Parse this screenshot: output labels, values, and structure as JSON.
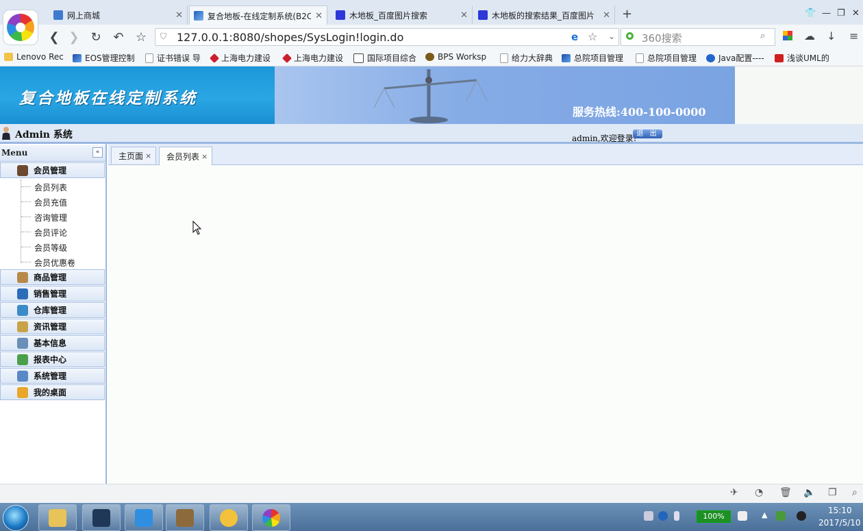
{
  "browser": {
    "tabs": [
      {
        "label": "网上商城",
        "active": false
      },
      {
        "label": "复合地板-在线定制系统(B2C",
        "active": true
      },
      {
        "label": "木地板_百度图片搜索",
        "active": false
      },
      {
        "label": "木地板的搜索结果_百度图片",
        "active": false
      }
    ],
    "new_tab": "+",
    "window_controls": [
      "shirt-icon",
      "minimize-icon",
      "restore-icon",
      "close-icon"
    ],
    "url": "127.0.0.1:8080/shopes/SysLogin!login.do",
    "search_placeholder": "360搜索",
    "bookmarks": [
      "Lenovo Rec",
      "EOS管理控制",
      "证书错误 导",
      "上海电力建设",
      "上海电力建设",
      "国际项目综合",
      "BPS Worksp",
      "给力大辞典",
      "总院项目管理",
      "总院项目管理",
      "Java配置----",
      "浅谈UML的"
    ]
  },
  "app": {
    "title": "复合地板在线定制系统",
    "hotline": "服务热线:400-100-0000",
    "admin_label": "Admin 系统",
    "welcome": "admin,欢迎登录!",
    "logout_label": "退 出"
  },
  "sidebar": {
    "title": "Menu",
    "collapse_icon": "«",
    "groups": [
      {
        "label": "会员管理",
        "expanded": true,
        "items": [
          "会员列表",
          "会员充值",
          "咨询管理",
          "会员评论",
          "会员等级",
          "会员优惠卷"
        ]
      },
      {
        "label": "商品管理"
      },
      {
        "label": "销售管理"
      },
      {
        "label": "仓库管理"
      },
      {
        "label": "资讯管理"
      },
      {
        "label": "基本信息"
      },
      {
        "label": "报表中心"
      },
      {
        "label": "系统管理"
      },
      {
        "label": "我的桌面"
      }
    ]
  },
  "page_tabs": [
    {
      "label": "主页面",
      "close": "×",
      "active": false
    },
    {
      "label": "会员列表",
      "close": "×",
      "active": true
    }
  ],
  "taskbar": {
    "battery": "100%",
    "time": "15:10",
    "date": "2017/5/10"
  },
  "colors": {
    "banner_blue": "#1c96d8",
    "sidebar_border": "#9ab7e0",
    "taskbar": "#5a80a8"
  }
}
